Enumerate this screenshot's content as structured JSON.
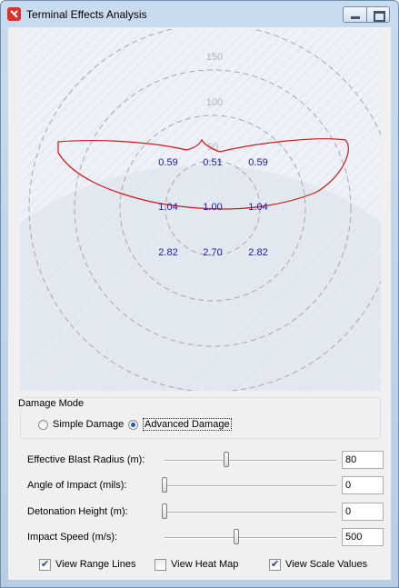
{
  "window": {
    "title": "Terminal Effects Analysis",
    "icon": "app-target-icon",
    "minimize_icon": "minimize-icon",
    "maximize_icon": "maximize-icon"
  },
  "plot": {
    "range_labels": [
      "150",
      "100",
      "50"
    ],
    "scale_values": [
      [
        "0.59",
        "0.51",
        "0.59"
      ],
      [
        "1.04",
        "1.00",
        "1.04"
      ],
      [
        "2.82",
        "2.70",
        "2.82"
      ]
    ],
    "colors": {
      "range_lines": "#a8a8a8",
      "damage_outline": "#cc1a1a",
      "scale_values": "#1b1ba6",
      "background": "#e6eaf3"
    }
  },
  "damage_mode": {
    "title": "Damage Mode",
    "options": [
      {
        "label": "Simple Damage",
        "selected": false
      },
      {
        "label": "Advanced Damage",
        "selected": true
      }
    ]
  },
  "params": [
    {
      "label": "Effective Blast Radius (m):",
      "value": "80",
      "slider_fraction": 0.36
    },
    {
      "label": "Angle of Impact (mils):",
      "value": "0",
      "slider_fraction": 0.0
    },
    {
      "label": "Detonation Height (m):",
      "value": "0",
      "slider_fraction": 0.0
    },
    {
      "label": "Impact Speed (m/s):",
      "value": "500",
      "slider_fraction": 0.42
    }
  ],
  "view_options": [
    {
      "label": "View Range Lines",
      "checked": true
    },
    {
      "label": "View Heat Map",
      "checked": false
    },
    {
      "label": "View Scale Values",
      "checked": true
    }
  ]
}
